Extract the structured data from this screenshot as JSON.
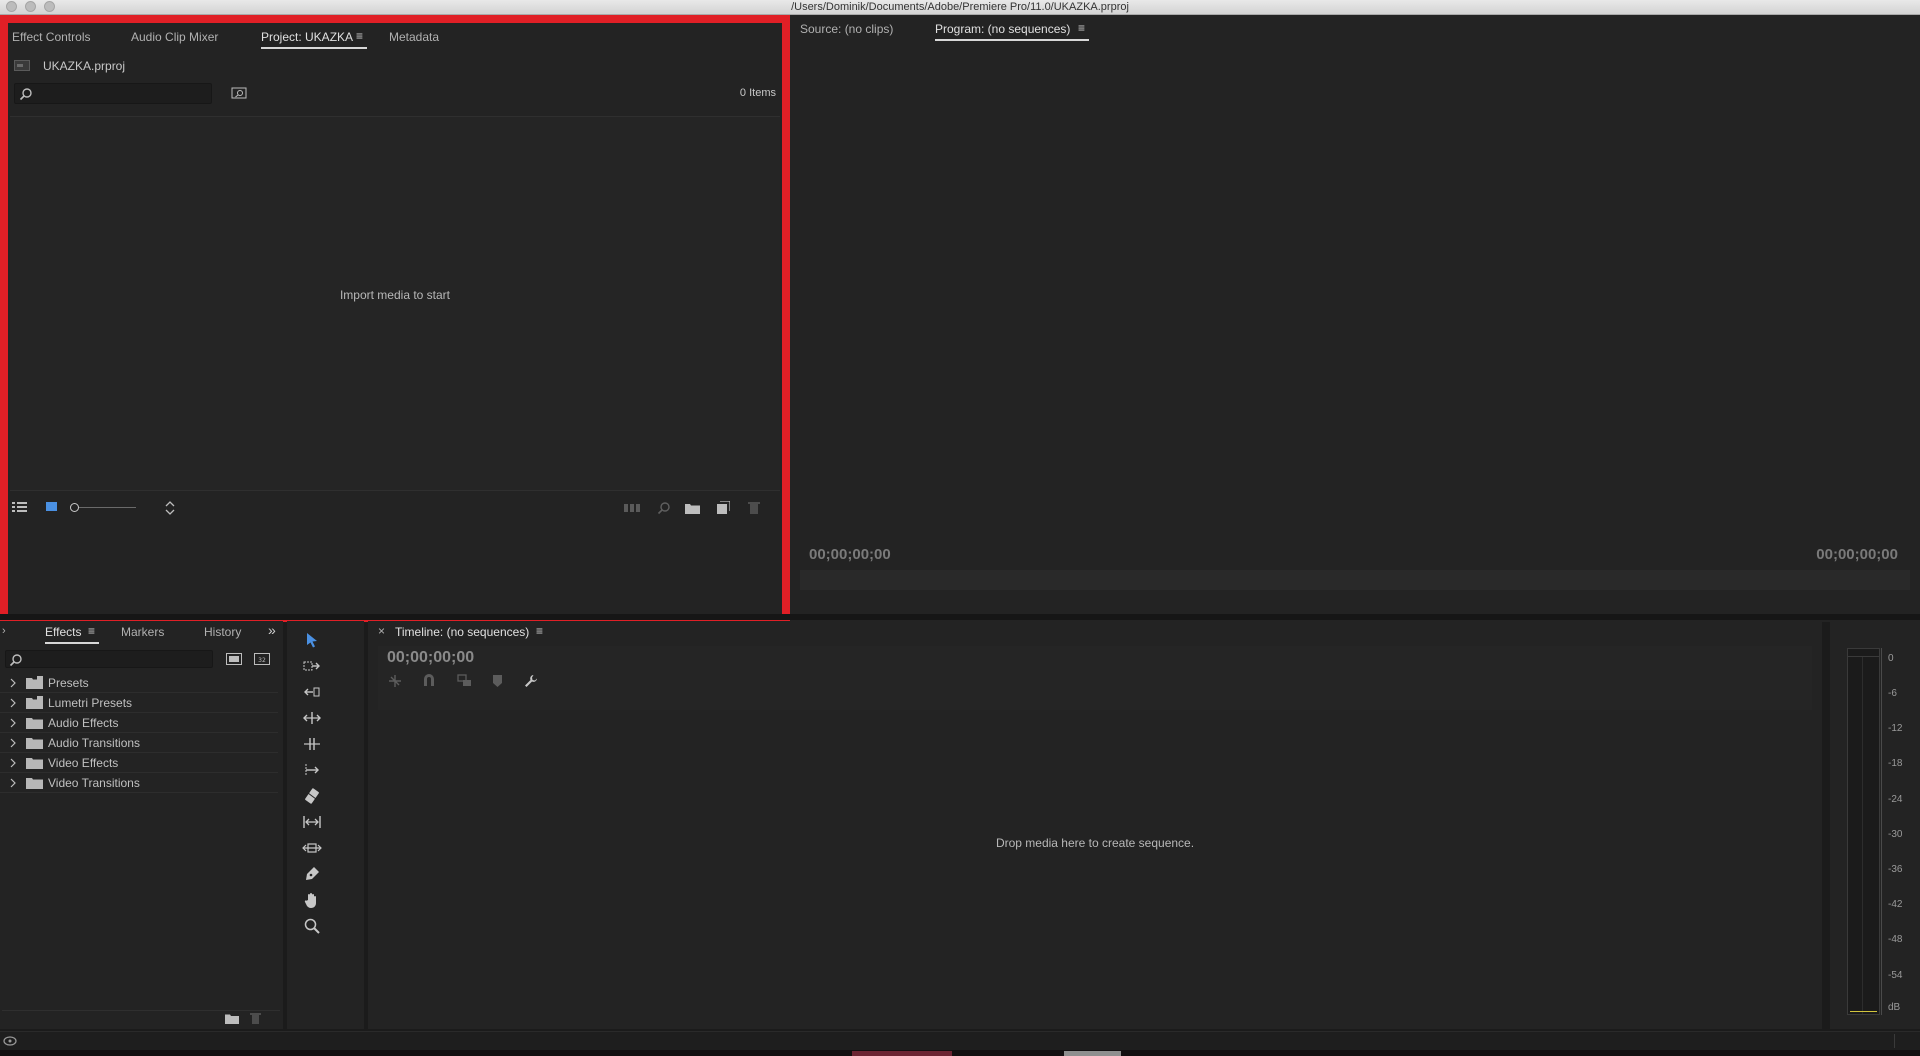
{
  "window": {
    "title": "/Users/Dominik/Documents/Adobe/Premiere Pro/11.0/UKAZKA.prproj"
  },
  "project_panel": {
    "tabs": [
      {
        "label": "Effect Controls",
        "active": false
      },
      {
        "label": "Audio Clip Mixer",
        "active": false
      },
      {
        "label": "Project: UKAZKA",
        "active": true
      },
      {
        "label": "Metadata",
        "active": false
      }
    ],
    "menu_glyph": "≡",
    "file_name": "UKAZKA.prproj",
    "item_count": "0 Items",
    "empty_message": "Import media to start",
    "highlight_color": "#e01f26"
  },
  "monitor_panel": {
    "tabs": [
      {
        "label": "Source: (no clips)",
        "active": false
      },
      {
        "label": "Program: (no sequences)",
        "active": true
      }
    ],
    "menu_glyph": "≡",
    "timecode_left": "00;00;00;00",
    "timecode_right": "00;00;00;00"
  },
  "effects_panel": {
    "tabs": [
      {
        "label": "Effects",
        "active": true
      },
      {
        "label": "Markers",
        "active": false
      },
      {
        "label": "History",
        "active": false
      }
    ],
    "menu_glyph": "≡",
    "overflow_glyph": "»",
    "folders": [
      "Presets",
      "Lumetri Presets",
      "Audio Effects",
      "Audio Transitions",
      "Video Effects",
      "Video Transitions"
    ]
  },
  "timeline_panel": {
    "close_glyph": "×",
    "title": "Timeline: (no sequences)",
    "menu_glyph": "≡",
    "timecode": "00;00;00;00",
    "empty_message": "Drop media here to create sequence."
  },
  "audio_meter": {
    "scale": [
      "0",
      "-6",
      "-12",
      "-18",
      "-24",
      "-30",
      "-36",
      "-42",
      "-48",
      "-54",
      "dB"
    ]
  },
  "colors": {
    "tool_active": "#4a90e2",
    "panel_bg": "#232323",
    "app_bg": "#1b1b1b"
  }
}
